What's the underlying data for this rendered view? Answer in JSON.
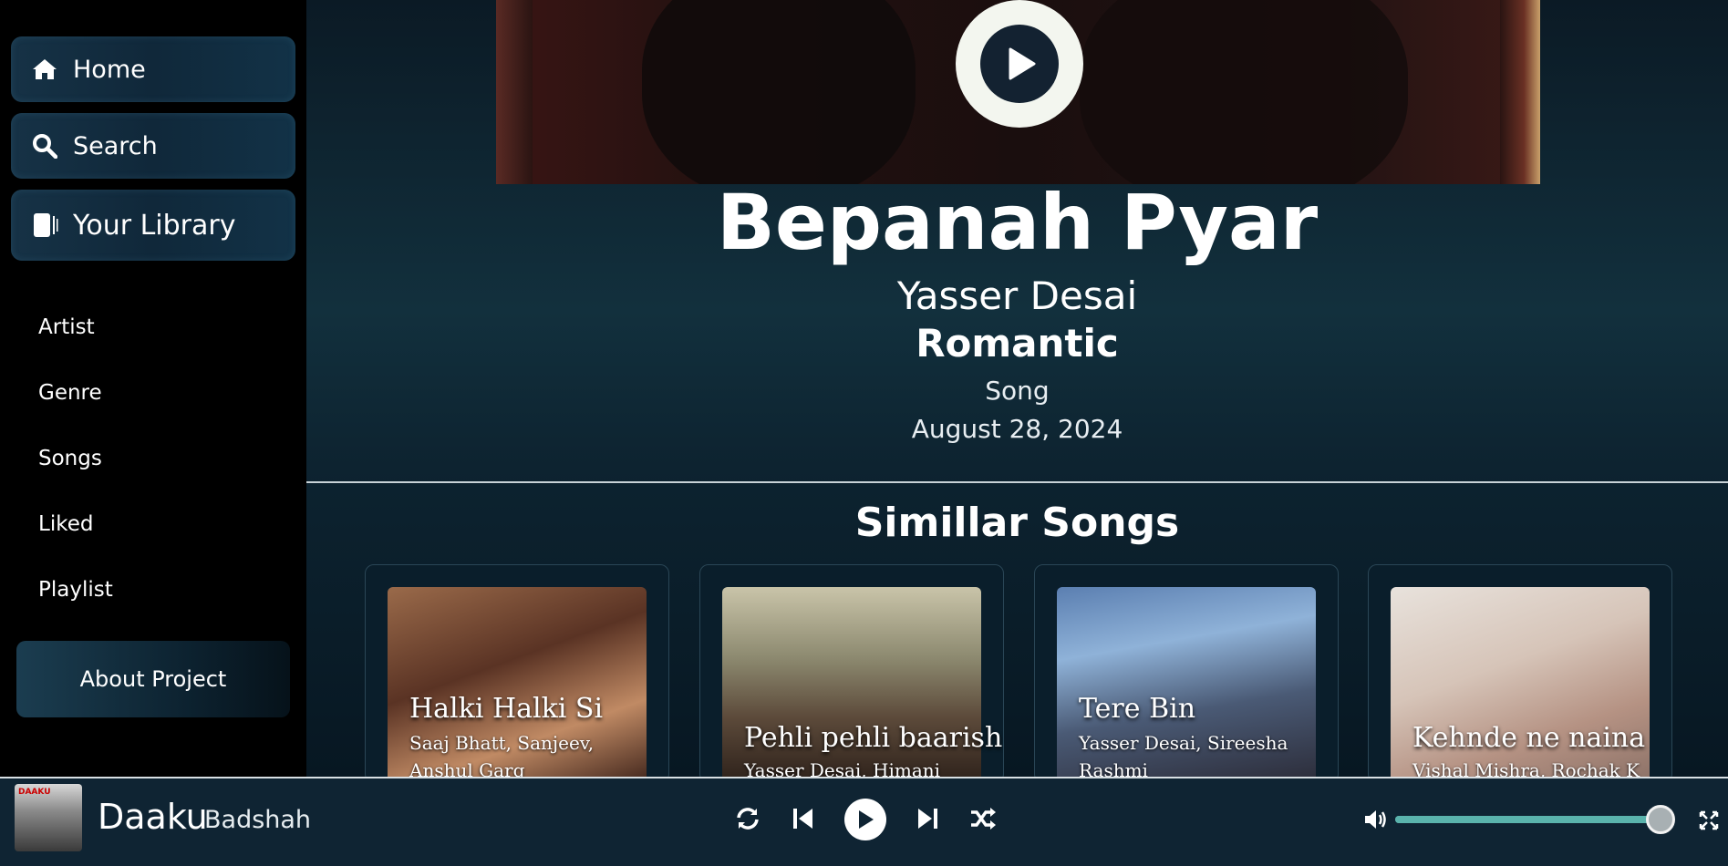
{
  "sidebar": {
    "home_label": "Home",
    "search_label": "Search",
    "library_label": "Your Library",
    "items": [
      {
        "label": "Artist"
      },
      {
        "label": "Genre"
      },
      {
        "label": "Songs"
      },
      {
        "label": "Liked"
      },
      {
        "label": "Playlist"
      }
    ],
    "about_label": "About Project"
  },
  "song": {
    "title": "Bepanah Pyar",
    "artist": "Yasser Desai",
    "genre": "Romantic",
    "type": "Song",
    "date": "August 28, 2024"
  },
  "similar": {
    "heading": "Simillar Songs",
    "cards": [
      {
        "title": "Halki Halki Si",
        "artists": "Saaj Bhatt, Sanjeev, Anshul Garg"
      },
      {
        "title": "Pehli pehli baarish",
        "artists": "Yasser Desai, Himani Rajat"
      },
      {
        "title": "Tere Bin",
        "artists": "Yasser Desai, Sireesha Rashmi"
      },
      {
        "title": "Kehnde ne naina",
        "artists": "Vishal Mishra, Rochak K"
      }
    ]
  },
  "player": {
    "title": "Daaku",
    "artist": "Badshah",
    "thumb_text": "DAAKU",
    "volume": 0.95
  },
  "colors": {
    "background": "#000000",
    "main_gradient": "#12303d",
    "player_bg": "#0f2433",
    "volume_track": "#4fa6a0"
  },
  "icons": [
    "home-icon",
    "search-icon",
    "library-icon",
    "play-icon",
    "repeat-icon",
    "previous-icon",
    "next-icon",
    "shuffle-icon",
    "volume-icon",
    "fullscreen-icon"
  ]
}
